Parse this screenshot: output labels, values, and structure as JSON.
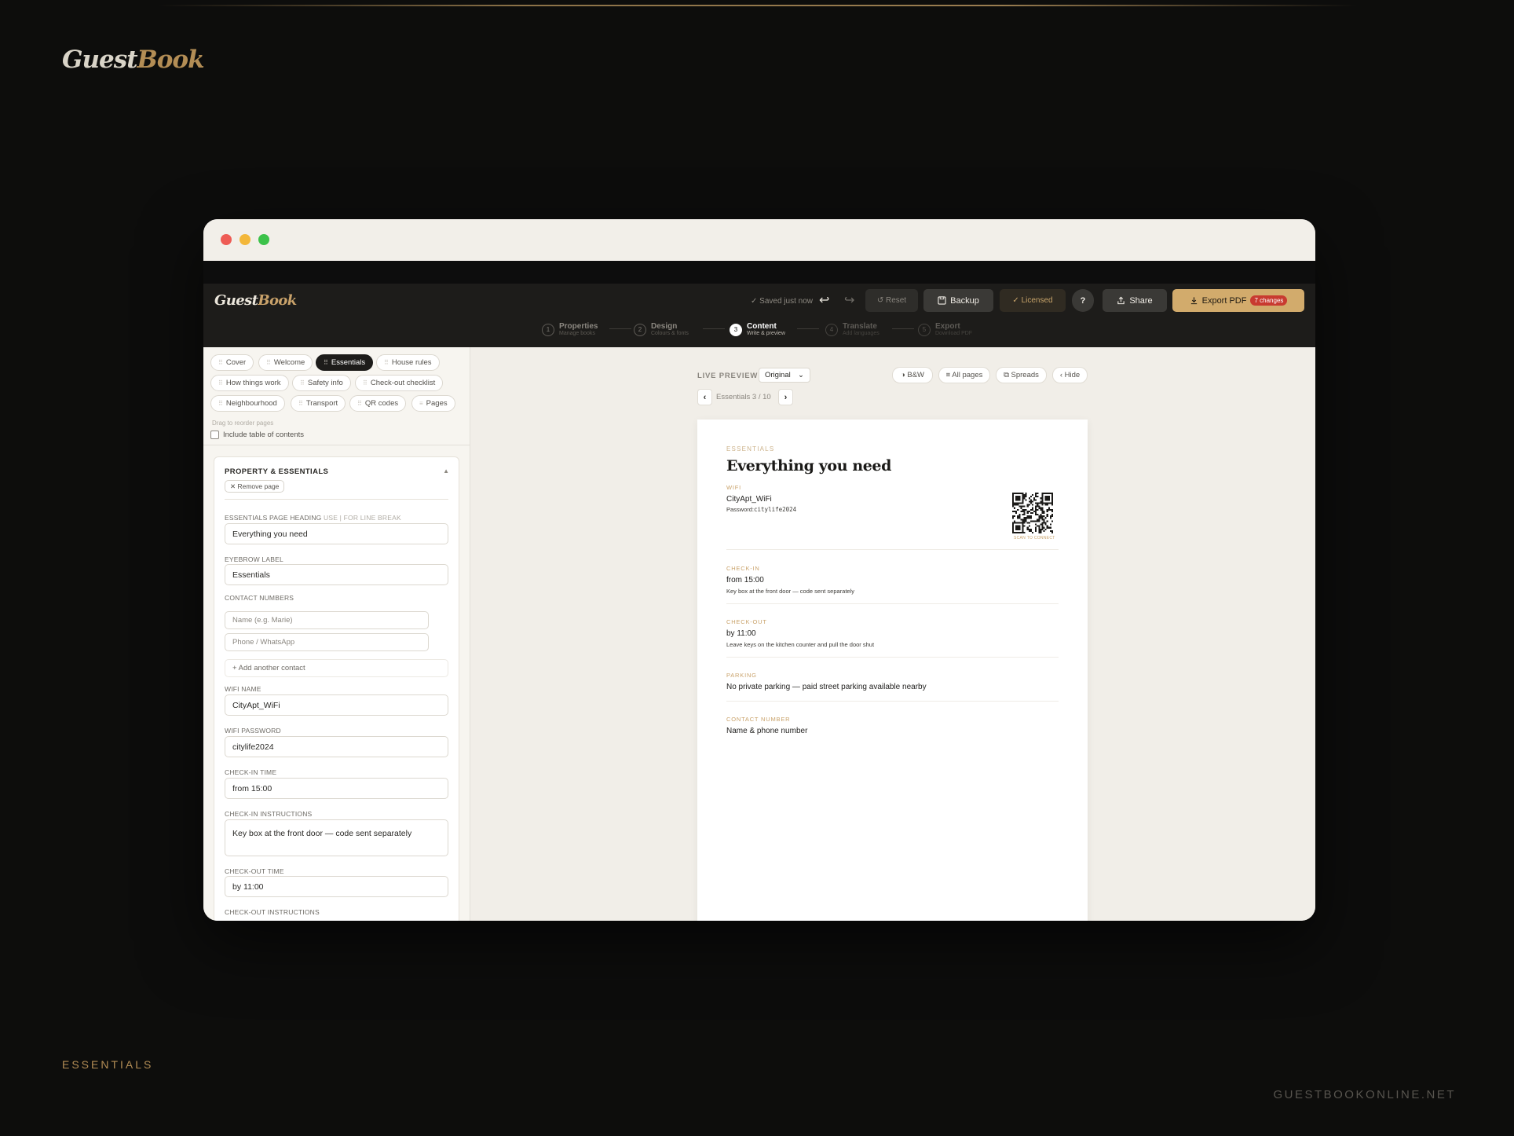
{
  "outer": {
    "logo_a": "Guest",
    "logo_b": "Book",
    "footer_label": "ESSENTIALS",
    "url": "GUESTBOOKONLINE.NET"
  },
  "app": {
    "logo_a": "Guest",
    "logo_b": "Book",
    "saved": "✓ Saved just now",
    "reset": "↺ Reset",
    "backup": "Backup",
    "licensed": "✓ Licensed",
    "help": "?",
    "share": "Share",
    "export": "Export PDF",
    "changes": "7 changes"
  },
  "steps": [
    {
      "n": "1",
      "title": "Properties",
      "sub": "Manage books"
    },
    {
      "n": "2",
      "title": "Design",
      "sub": "Colours & fonts"
    },
    {
      "n": "3",
      "title": "Content",
      "sub": "Write & preview"
    },
    {
      "n": "4",
      "title": "Translate",
      "sub": "Add languages"
    },
    {
      "n": "5",
      "title": "Export",
      "sub": "Download PDF"
    }
  ],
  "pages": [
    "Cover",
    "Welcome",
    "Essentials",
    "House rules",
    "How things work",
    "Safety info",
    "Check-out checklist",
    "Neighbourhood",
    "Transport",
    "QR codes",
    "Pages"
  ],
  "drag_note": "Drag to reorder pages",
  "toc_label": "Include table of contents",
  "editor": {
    "section_title": "PROPERTY & ESSENTIALS",
    "remove": "✕ Remove page",
    "heading_label": "ESSENTIALS PAGE HEADING",
    "heading_hint": "USE | FOR LINE BREAK",
    "heading_value": "Everything you need",
    "eyebrow_label": "EYEBROW LABEL",
    "eyebrow_value": "Essentials",
    "contacts_label": "CONTACT NUMBERS",
    "contact_name_ph": "Name (e.g. Marie)",
    "contact_phone_ph": "Phone / WhatsApp",
    "add_contact": "+ Add another contact",
    "wifi_name_label": "WIFI NAME",
    "wifi_name_value": "CityApt_WiFi",
    "wifi_pw_label": "WIFI PASSWORD",
    "wifi_pw_value": "citylife2024",
    "checkin_label": "CHECK-IN TIME",
    "checkin_value": "from 15:00",
    "checkin_instr_label": "CHECK-IN INSTRUCTIONS",
    "checkin_instr_value": "Key box at the front door — code sent separately",
    "checkout_label": "CHECK-OUT TIME",
    "checkout_value": "by 11:00",
    "checkout_instr_label": "CHECK-OUT INSTRUCTIONS"
  },
  "preview": {
    "live_label": "LIVE PREVIEW",
    "mode": "Original",
    "bw": "◑ B&W",
    "all_pages": "≡ All pages",
    "spreads": "⧉ Spreads",
    "hide": "‹ Hide",
    "nav": "Essentials 3 / 10",
    "eyebrow": "ESSENTIALS",
    "heading": "Everything you need",
    "wifi_label": "WIFI",
    "wifi_name": "CityApt_WiFi",
    "password_prefix": "Password:",
    "password": "citylife2024",
    "qr_label": "SCAN TO CONNECT",
    "checkin_label": "CHECK-IN",
    "checkin_value": "from 15:00",
    "checkin_note": "Key box at the front door — code sent separately",
    "checkout_label": "CHECK-OUT",
    "checkout_value": "by 11:00",
    "checkout_note": "Leave keys on the kitchen counter and pull the door shut",
    "parking_label": "PARKING",
    "parking_value": "No private parking — paid street parking available nearby",
    "contact_label": "CONTACT NUMBER",
    "contact_value": "Name & phone number"
  },
  "colors": {
    "accent": "#d2ab6c",
    "dark": "#1d1c1a",
    "badge": "#c83a30"
  }
}
